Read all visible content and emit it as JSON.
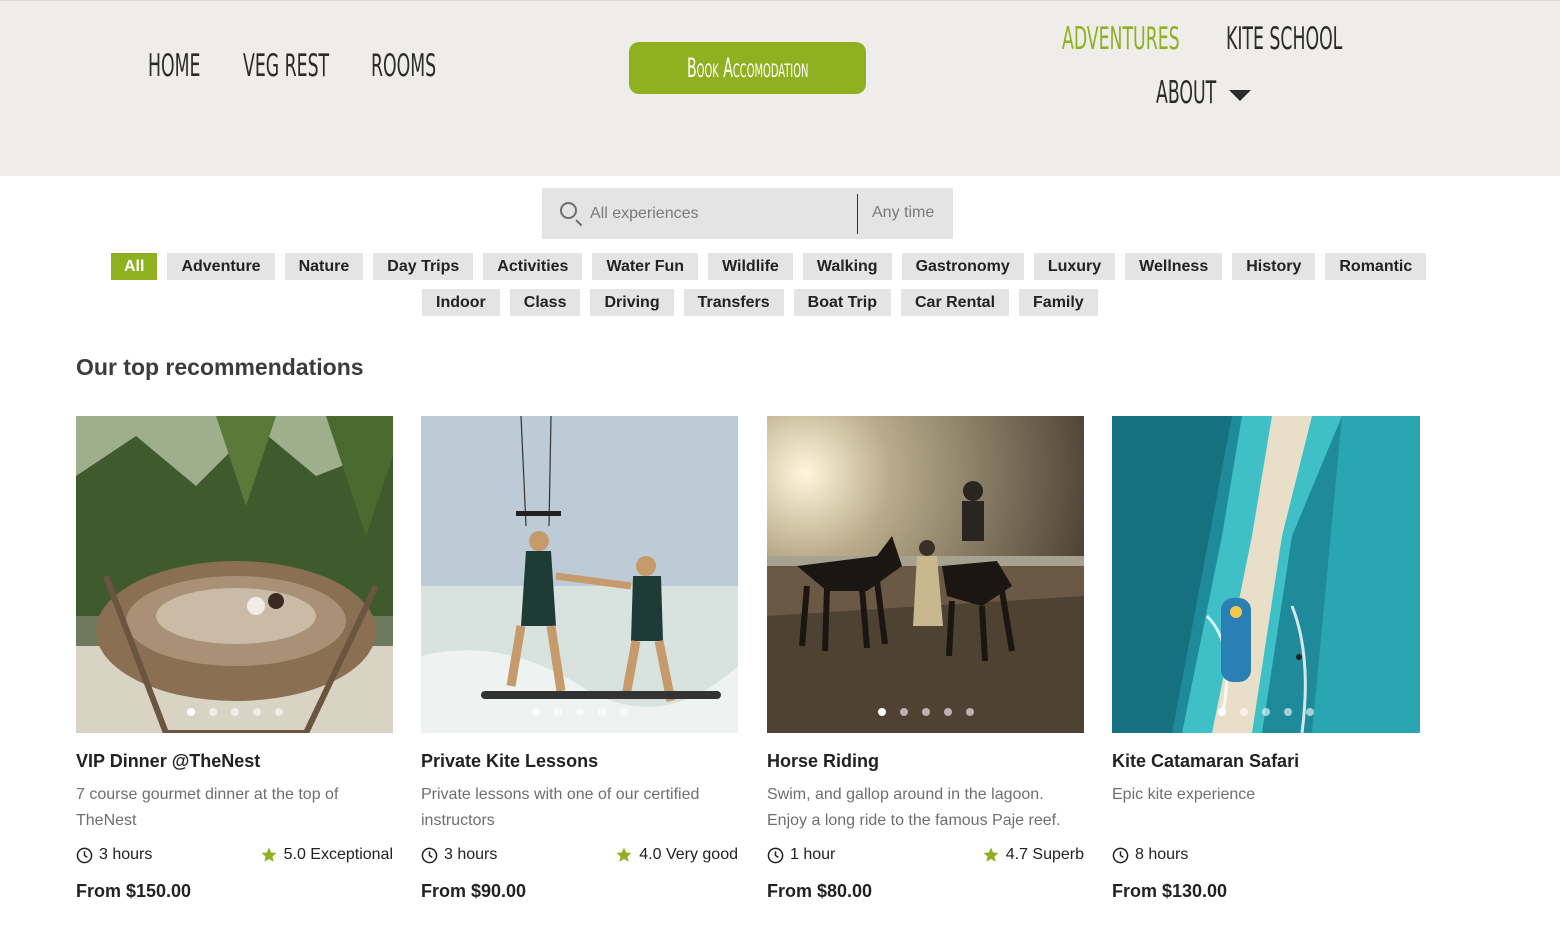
{
  "nav": {
    "home": "Home",
    "veg_rest": "Veg Rest",
    "rooms": "Rooms",
    "book_button": "Book Accomodation",
    "adventures": "Adventures",
    "kite_school": "Kite School",
    "about": "About"
  },
  "colors": {
    "accent": "#8fb021",
    "header_bg": "#efedea",
    "chip_bg": "#e4e4e4"
  },
  "search": {
    "placeholder": "All experiences",
    "time": "Any time"
  },
  "categories_row1": [
    "All",
    "Adventure",
    "Nature",
    "Day Trips",
    "Activities",
    "Water Fun",
    "Wildlife",
    "Walking",
    "Gastronomy",
    "Luxury",
    "Wellness",
    "History",
    "Romantic"
  ],
  "categories_row2": [
    "Indoor",
    "Class",
    "Driving",
    "Transfers",
    "Boat Trip",
    "Car Rental",
    "Family"
  ],
  "active_category": "All",
  "section_title": "Our top recommendations",
  "cards": [
    {
      "title": "VIP Dinner @TheNest",
      "desc": "7 course gourmet dinner at the top of TheNest",
      "duration": "3 hours",
      "rating": "5.0 Exceptional",
      "price": "From $150.00"
    },
    {
      "title": "Private Kite Lessons",
      "desc": "Private lessons with one of our certified instructors",
      "duration": "3 hours",
      "rating": "4.0 Very good",
      "price": "From $90.00"
    },
    {
      "title": "Horse Riding",
      "desc": "Swim, and gallop around in the lagoon. Enjoy a long ride to the famous Paje reef. Walk…",
      "duration": "1 hour",
      "rating": "4.7 Superb",
      "price": "From $80.00"
    },
    {
      "title": "Kite Catamaran Safari",
      "desc": "Epic kite experience",
      "duration": "8 hours",
      "rating": "",
      "price": "From $130.00"
    }
  ]
}
